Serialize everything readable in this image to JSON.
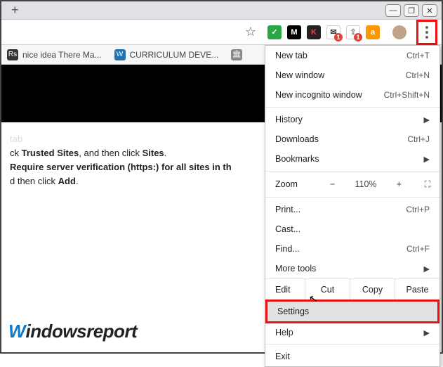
{
  "window_controls": {
    "min": "—",
    "max": "❐",
    "close": "✕"
  },
  "toolbar": {
    "star": "☆",
    "ext": [
      {
        "bg": "#28a745",
        "txt": "✓",
        "name": "grammarly-icon"
      },
      {
        "bg": "#000000",
        "txt": "M",
        "name": "m-icon"
      },
      {
        "bg": "#222",
        "txt": "K",
        "name": "k-icon",
        "color": "#e44"
      },
      {
        "bg": "#fff",
        "txt": "✉",
        "name": "mail-icon",
        "color": "#333",
        "badge": "1"
      },
      {
        "bg": "#fff",
        "txt": "⇪",
        "name": "save-icon",
        "color": "#888",
        "badge": "1"
      },
      {
        "bg": "#ff9800",
        "txt": "a",
        "name": "amazon-icon"
      }
    ],
    "menu_trigger": "more-icon"
  },
  "bookmarks": [
    {
      "icon_bg": "#333",
      "icon_txt": "Rs",
      "label": "nice idea There Ma..."
    },
    {
      "icon_bg": "#2271b1",
      "icon_txt": "W",
      "label": "CURRICULUM DEVE..."
    },
    {
      "icon_bg": "#888",
      "icon_txt": "🏛",
      "label": ""
    }
  ],
  "page": {
    "tab_hint": "tab",
    "line1_pre": "ck ",
    "line1_b1": "Trusted Sites",
    "line1_mid": ", and then click ",
    "line1_b2": "Sites",
    "line1_post": ".",
    "line2_b": "Require server verification (https:) for all sites in th",
    "line3_pre": "d then click ",
    "line3_b": "Add",
    "line3_post": ".",
    "logo_w": "W",
    "logo_rest": "indowsreport"
  },
  "menu": {
    "newtab": "New tab",
    "newtab_k": "Ctrl+T",
    "newwin": "New window",
    "newwin_k": "Ctrl+N",
    "incog": "New incognito window",
    "incog_k": "Ctrl+Shift+N",
    "history": "History",
    "downloads": "Downloads",
    "downloads_k": "Ctrl+J",
    "bookmarks": "Bookmarks",
    "zoom_lbl": "Zoom",
    "zoom_minus": "−",
    "zoom_val": "110%",
    "zoom_plus": "+",
    "print": "Print...",
    "print_k": "Ctrl+P",
    "cast": "Cast...",
    "find": "Find...",
    "find_k": "Ctrl+F",
    "moretools": "More tools",
    "edit_lbl": "Edit",
    "cut": "Cut",
    "copy": "Copy",
    "paste": "Paste",
    "settings": "Settings",
    "help": "Help",
    "exit": "Exit"
  }
}
